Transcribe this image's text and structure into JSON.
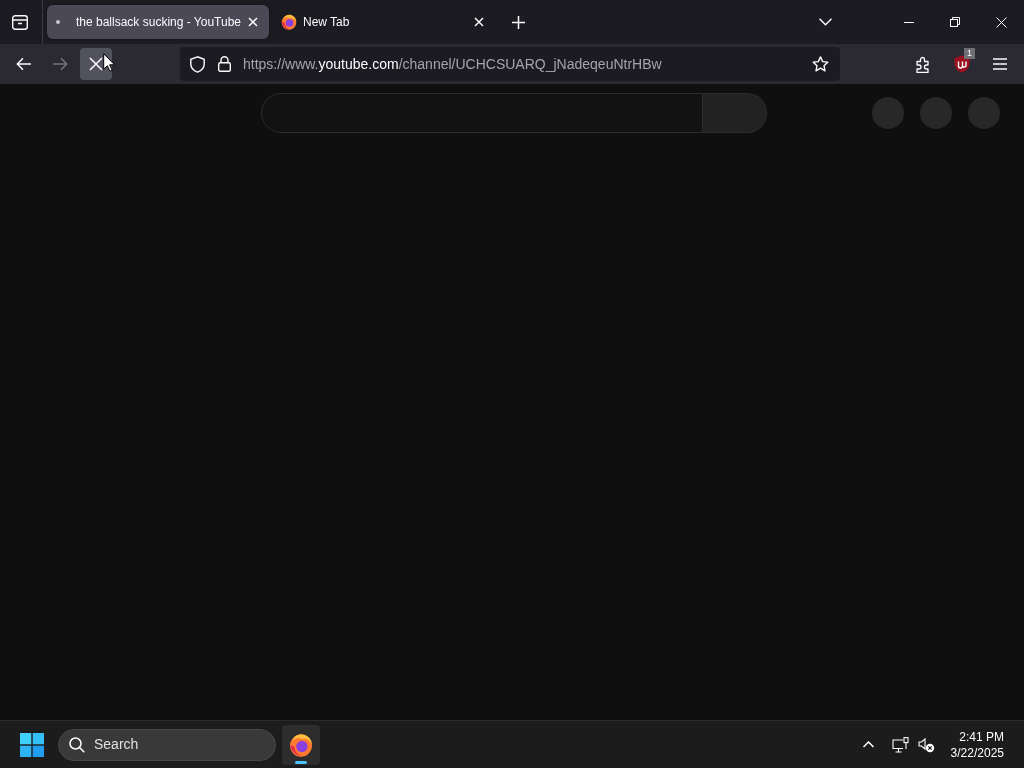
{
  "tab_bar": {
    "tabs": [
      {
        "title": "the ballsack sucking - YouTube",
        "selected": true,
        "loading": true
      },
      {
        "title": "New Tab",
        "selected": false,
        "loading": false
      }
    ]
  },
  "nav_bar": {
    "buttons": [
      {
        "kind": "back",
        "disabled": false,
        "hovered": false
      },
      {
        "kind": "forward",
        "disabled": true,
        "hovered": false
      },
      {
        "kind": "stop",
        "disabled": false,
        "hovered": true
      }
    ],
    "url": {
      "prefix": "https://www.",
      "domain": "youtube.com",
      "path": "/channel/UCHCSUARQ_jNadeqeuNtrHBw"
    },
    "extension_badge": "1"
  },
  "taskbar": {
    "search": {
      "placeholder": "Search"
    },
    "pinned_apps": [
      {
        "running": true
      }
    ],
    "tray": {
      "volume_muted": true
    },
    "clock": {
      "time": "2:41 PM",
      "date": "3/22/2025"
    }
  }
}
